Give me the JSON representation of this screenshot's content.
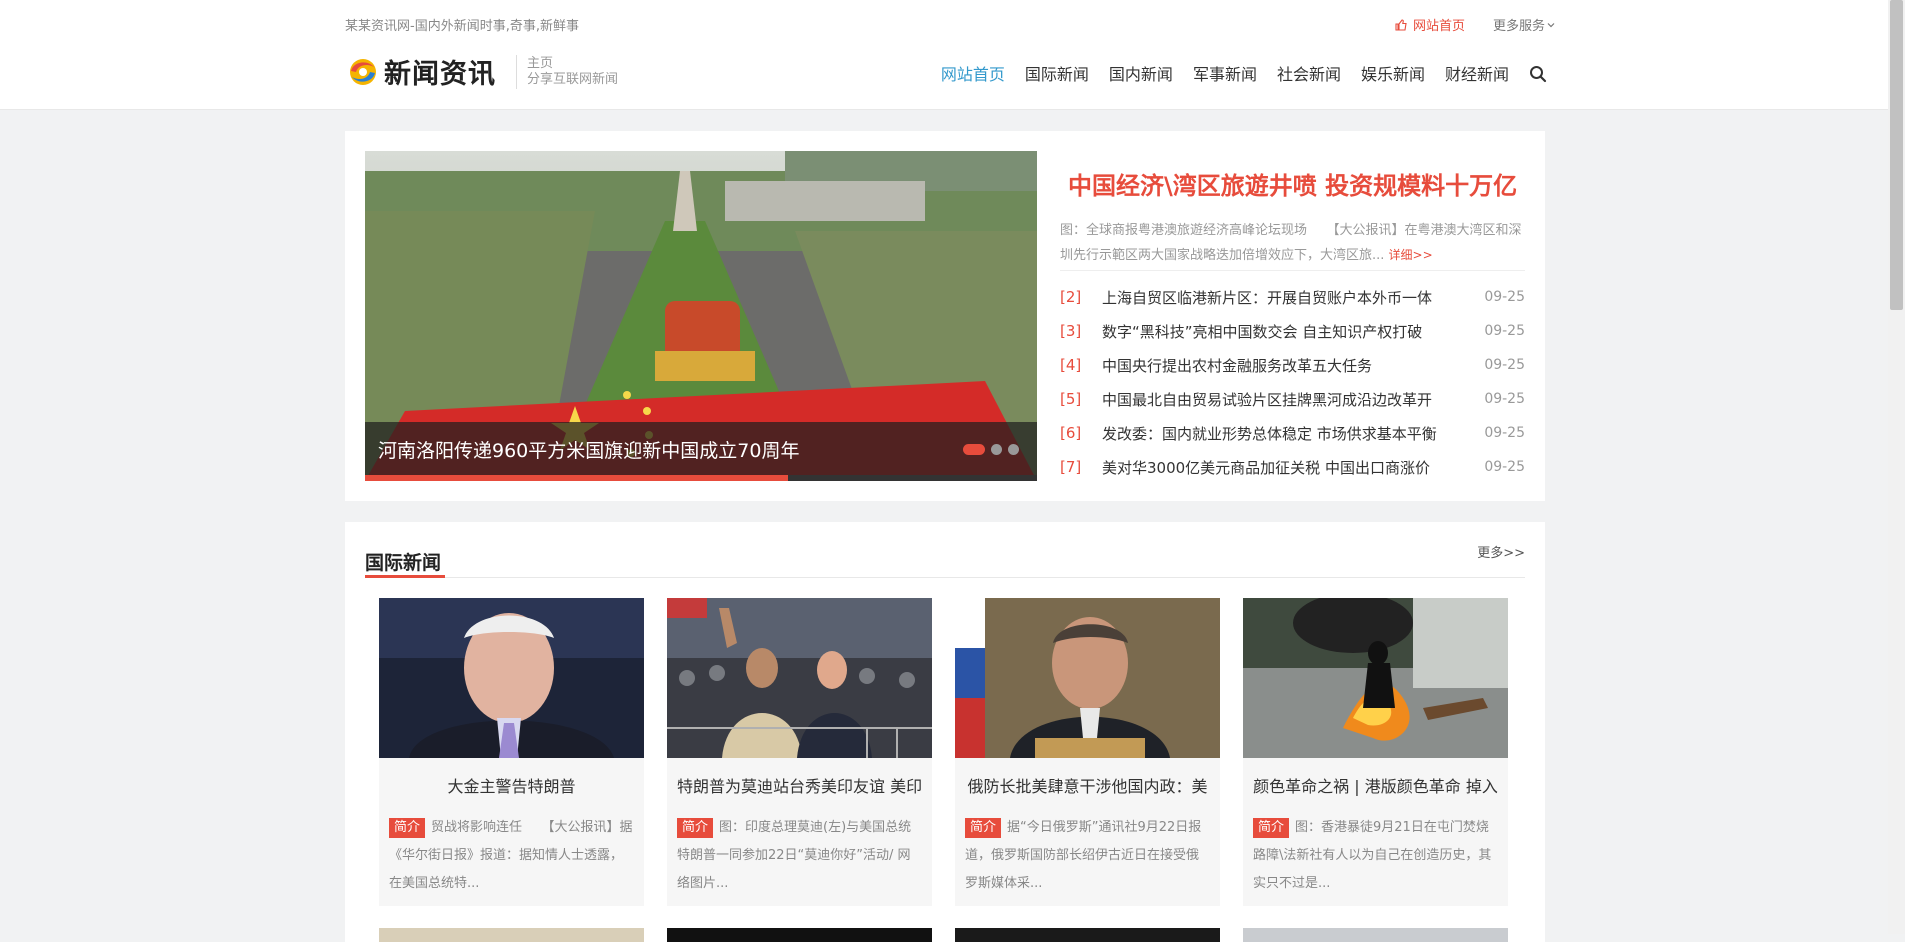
{
  "topbar": {
    "tagline": "某某资讯网-国内外新闻时事,奇事,新鲜事",
    "home_link": "网站首页",
    "more_services": "更多服务"
  },
  "logo": {
    "name": "新闻资讯",
    "sub1": "主页",
    "sub2": "分享互联网新闻"
  },
  "nav": {
    "items": [
      "网站首页",
      "国际新闻",
      "国内新闻",
      "军事新闻",
      "社会新闻",
      "娱乐新闻",
      "财经新闻"
    ],
    "active_index": 0
  },
  "slider": {
    "caption": "河南洛阳传递960平方米国旗迎新中国成立70周年",
    "slide_count": 3,
    "active_slide": 1,
    "progress_fraction": 0.63
  },
  "featured": {
    "headline": "中国经济\\湾区旅遊井喷 投资规模料十万亿",
    "summary": "图：全球商报粤港澳旅遊经济高峰论坛现场　　【大公报讯】在粤港澳大湾区和深圳先行示範区两大国家战略迭加倍增效应下，大湾区旅...",
    "more": "详细>>"
  },
  "news_list": [
    {
      "num": "[2]",
      "title": "上海自贸区临港新片区：开展自贸账户本外币一体",
      "date": "09-25"
    },
    {
      "num": "[3]",
      "title": "数字“黑科技”亮相中国数交会 自主知识产权打破",
      "date": "09-25"
    },
    {
      "num": "[4]",
      "title": "中国央行提出农村金融服务改革五大任务",
      "date": "09-25"
    },
    {
      "num": "[5]",
      "title": "中国最北自由贸易试验片区挂牌黑河成沿边改革开",
      "date": "09-25"
    },
    {
      "num": "[6]",
      "title": "发改委：国内就业形势总体稳定 市场供求基本平衡",
      "date": "09-25"
    },
    {
      "num": "[7]",
      "title": "美对华3000亿美元商品加征关税 中国出口商涨价",
      "date": "09-25"
    }
  ],
  "section": {
    "title": "国际新闻",
    "more": "更多>>",
    "tag": "简介",
    "cards": [
      {
        "title": "大金主警告特朗普",
        "desc": "贸战将影响连任　　【大公报讯】据《华尔街日报》报道：据知情人士透露，在美国总统特..."
      },
      {
        "title": "特朗普为莫迪站台秀美印友谊 美印",
        "desc": "图：印度总理莫迪(左)与美国总统特朗普一同参加22日“莫迪你好”活动/ 网络图片..."
      },
      {
        "title": "俄防长批美肆意干涉他国内政：美",
        "desc": "据“今日俄罗斯”通讯社9月22日报道，俄罗斯国防部长绍伊古近日在接受俄罗斯媒体采..."
      },
      {
        "title": "颜色革命之祸 | 港版颜色革命 掉入",
        "desc": "图：香港暴徒9月21日在屯门焚烧路障\\法新社有人以为自己在创造历史，其实只不过是..."
      }
    ]
  },
  "colors": {
    "accent": "#e74c3c",
    "nav_active": "#3399cc"
  }
}
